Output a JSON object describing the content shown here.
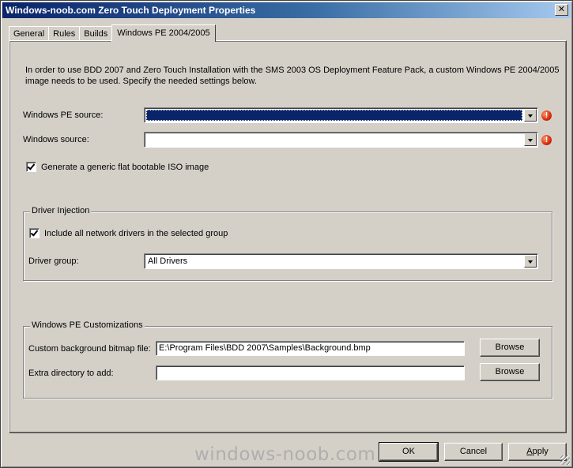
{
  "window": {
    "title": "Windows-noob.com Zero Touch Deployment Properties",
    "close_glyph": "✕"
  },
  "tabs": [
    {
      "label": "General"
    },
    {
      "label": "Rules"
    },
    {
      "label": "Builds"
    },
    {
      "label": "Windows PE 2004/2005",
      "active": true
    }
  ],
  "intro": "In order to use BDD 2007 and Zero Touch Installation with the SMS 2003 OS Deployment Feature Pack, a custom Windows PE 2004/2005 image needs to be used.  Specify the needed settings below.",
  "pe_source": {
    "label": "Windows PE source:",
    "value": ""
  },
  "windows_source": {
    "label": "Windows source:",
    "value": ""
  },
  "error_glyph": "!",
  "iso_option": {
    "label": "Generate a generic flat bootable ISO image",
    "checked": true
  },
  "driver_injection": {
    "legend": "Driver Injection",
    "include_label": "Include all network drivers in the selected group",
    "include_checked": true,
    "group_label": "Driver group:",
    "group_value": "All Drivers"
  },
  "customizations": {
    "legend": "Windows PE Customizations",
    "bitmap_label": "Custom background bitmap file:",
    "bitmap_value": "E:\\Program Files\\BDD 2007\\Samples\\Background.bmp",
    "extra_label": "Extra directory to add:",
    "extra_value": "",
    "browse_label": "Browse"
  },
  "footer": {
    "ok": "OK",
    "cancel": "Cancel",
    "apply_u": "A",
    "apply_rest": "pply"
  },
  "watermark": "windows-noob.com",
  "colors": {
    "selection": "#0a246a",
    "face": "#d4d0c8",
    "error": "#d6290c"
  }
}
